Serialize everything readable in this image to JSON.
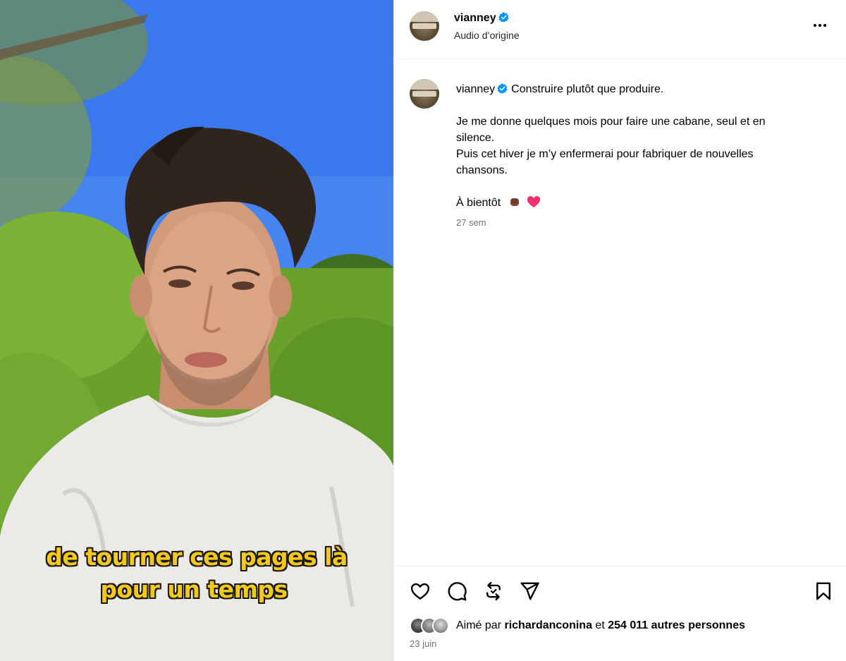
{
  "header": {
    "username": "vianney",
    "audio": "Audio d’origine",
    "more_icon": "more-horizontal-icon"
  },
  "media": {
    "subtitle_line1": "de tourner ces pages là",
    "subtitle_line2": "pour un temps"
  },
  "caption": {
    "username": "vianney",
    "line1": "Construire plutôt que produire.",
    "line2": "Je me donne quelques mois pour faire une cabane, seul et en",
    "line3": "silence.",
    "line4": "Puis cet hiver je m’y enfermerai pour fabriquer de nouvelles",
    "line5": "chansons.",
    "line6": "À bientôt",
    "time_ago": "27 sem"
  },
  "actions": {
    "icons": [
      "heart-icon",
      "comment-icon",
      "repost-icon",
      "share-icon",
      "bookmark-icon"
    ]
  },
  "likes": {
    "prefix": "Aimé par",
    "user": "richardanconina",
    "middle": "et",
    "others": "254 011 autres personnes"
  },
  "date": "23 juin",
  "colors": {
    "verified": "#0095f6",
    "subtitle": "#f5c81a",
    "muted": "#737373"
  }
}
